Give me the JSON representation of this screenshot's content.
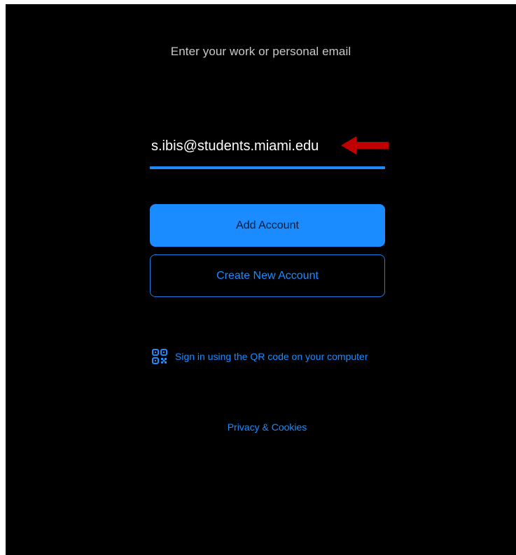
{
  "signin": {
    "prompt": "Enter your work or personal email",
    "email": {
      "value": "s.ibis@students.miami.edu",
      "placeholder": ""
    },
    "add_account_label": "Add Account",
    "create_account_label": "Create New Account",
    "qr_link_label": "Sign in using the QR code on your computer",
    "privacy_label": "Privacy & Cookies"
  },
  "icons": {
    "qr": "qr-code-icon",
    "annotation": "red-arrow-annotation"
  },
  "colors": {
    "background": "#000000",
    "accent": "#1a8cff",
    "prompt_text": "#c8c8c8",
    "annotation_arrow": "#c00000"
  }
}
